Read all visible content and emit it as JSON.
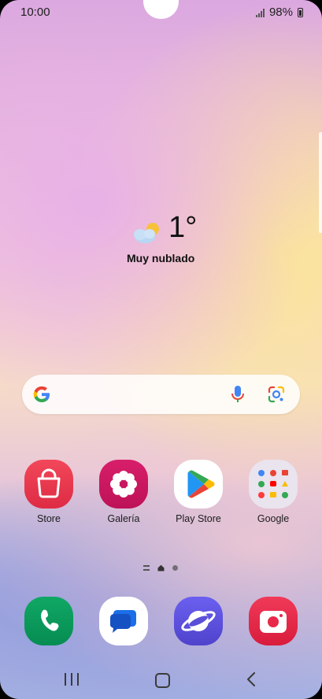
{
  "status_bar": {
    "time": "10:00",
    "battery": "98%",
    "icons": [
      "signal-icon",
      "battery-charging-icon"
    ]
  },
  "weather": {
    "temperature": "1°",
    "condition": "Muy nublado",
    "icon": "partly-cloudy-icon"
  },
  "search_widget": {
    "icons": [
      "google-g-icon",
      "mic-icon",
      "google-lens-icon"
    ]
  },
  "apps": [
    {
      "label": "Store",
      "icon": "store-bag-icon",
      "color": "#e8374b"
    },
    {
      "label": "Galería",
      "icon": "gallery-flower-icon",
      "color": "#c8175f"
    },
    {
      "label": "Play Store",
      "icon": "play-store-icon",
      "color": "#ffffff"
    },
    {
      "label": "Google",
      "icon": "google-folder-icon",
      "color": "#e6e3ea"
    }
  ],
  "dock": [
    {
      "name": "phone",
      "icon": "phone-icon",
      "color": "#0a9a5d"
    },
    {
      "name": "messages",
      "icon": "messages-icon",
      "color": "#ffffff"
    },
    {
      "name": "internet",
      "icon": "internet-icon",
      "color": "#5b4fd8"
    },
    {
      "name": "camera",
      "icon": "camera-icon",
      "color": "#e8294a"
    }
  ],
  "page_indicator": {
    "pages": 3,
    "current": 2
  },
  "nav_bar": {
    "icons": [
      "recents-icon",
      "home-icon",
      "back-icon"
    ]
  }
}
